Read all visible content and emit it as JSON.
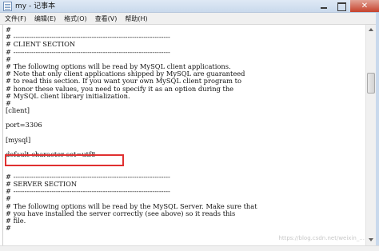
{
  "window": {
    "title": "my - 记事本"
  },
  "menu": {
    "items": [
      "文件(F)",
      "编辑(E)",
      "格式(O)",
      "查看(V)",
      "帮助(H)"
    ]
  },
  "editor": {
    "lines": [
      "#",
      "# ----------------------------------------------------------------------",
      "# CLIENT SECTION",
      "# ----------------------------------------------------------------------",
      "#",
      "# The following options will be read by MySQL client applications.",
      "# Note that only client applications shipped by MySQL are guaranteed",
      "# to read this section. If you want your own MySQL client program to",
      "# honor these values, you need to specify it as an option during the",
      "# MySQL client library initialization.",
      "#",
      "[client]",
      "",
      "port=3306",
      "",
      "[mysql]",
      "",
      "default-character-set=utf8",
      "",
      "",
      "# ----------------------------------------------------------------------",
      "# SERVER SECTION",
      "# ----------------------------------------------------------------------",
      "#",
      "# The following options will be read by the MySQL Server. Make sure that",
      "# you have installed the server correctly (see above) so it reads this",
      "# file.",
      "#"
    ]
  },
  "watermark": "https://blog.csdn.net/weixin_..."
}
